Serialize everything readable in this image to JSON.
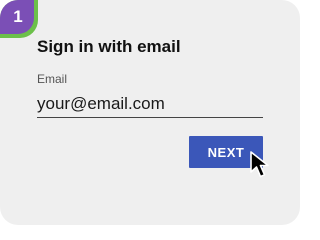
{
  "step": {
    "number": "1"
  },
  "form": {
    "title": "Sign in with email",
    "email_label": "Email",
    "email_value": "your@email.com",
    "next_label": "NEXT"
  },
  "icons": {
    "pointer": "hand-pointer-icon"
  },
  "colors": {
    "card_background": "#efefef",
    "badge_purple": "#7b4fb6",
    "badge_green": "#6cc04a",
    "button_blue": "#3b57b9"
  }
}
